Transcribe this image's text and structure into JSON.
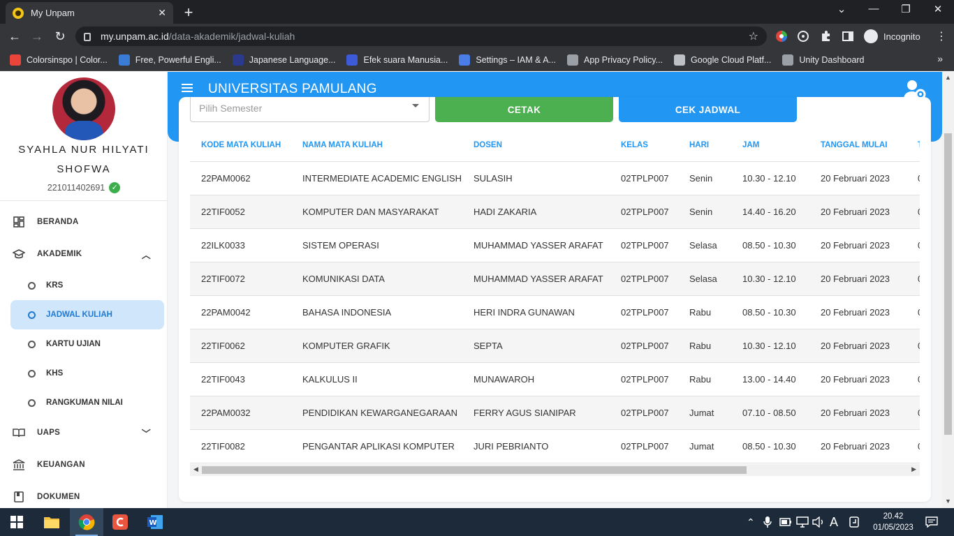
{
  "browser": {
    "tab_title": "My Unpam",
    "tab_close": "✕",
    "new_tab": "+",
    "url_host": "my.unpam.ac.id",
    "url_path": "/data-akademik/jadwal-kuliah",
    "profile_label": "Incognito",
    "window_controls": [
      "⌄",
      "—",
      "❐",
      "✕"
    ]
  },
  "bookmarks": [
    {
      "label": "Colorsinspo | Color...",
      "color": "#e9453a"
    },
    {
      "label": "Free, Powerful Engli...",
      "color": "#3a7bd5"
    },
    {
      "label": "Japanese Language...",
      "color": "#2b3a8c"
    },
    {
      "label": "Efek suara Manusia...",
      "color": "#3d5bd9"
    },
    {
      "label": "Settings – IAM & A...",
      "color": "#4a7de8"
    },
    {
      "label": "App Privacy Policy...",
      "color": "#9aa0a6"
    },
    {
      "label": "Google Cloud Platf...",
      "color": "#bdc1c6"
    },
    {
      "label": "Unity Dashboard",
      "color": "#9aa0a6"
    }
  ],
  "bookmarks_more": "»",
  "profile": {
    "name": "SYAHLA NUR HILYATI SHOFWA",
    "nim": "221011402691",
    "verified_mark": "✓"
  },
  "sidebar": {
    "items": [
      {
        "label": "BERANDA",
        "icon": "dashboard-icon"
      },
      {
        "label": "AKADEMIK",
        "icon": "school-icon"
      },
      {
        "label": "UAPS",
        "icon": "book-icon"
      },
      {
        "label": "KEUANGAN",
        "icon": "bank-icon"
      },
      {
        "label": "DOKUMEN",
        "icon": "document-icon"
      }
    ],
    "akademik_sub": [
      {
        "label": "KRS"
      },
      {
        "label": "JADWAL KULIAH"
      },
      {
        "label": "KARTU UJIAN"
      },
      {
        "label": "KHS"
      },
      {
        "label": "RANGKUMAN NILAI"
      }
    ]
  },
  "header": {
    "brand": "UNIVERSITAS PAMULANG",
    "accent": "#2196f3"
  },
  "controls": {
    "semester_placeholder": "Pilih Semester",
    "cetak_label": "CETAK",
    "cek_jadwal_label": "CEK JADWAL"
  },
  "table": {
    "columns": [
      "KODE MATA KULIAH",
      "NAMA MATA KULIAH",
      "DOSEN",
      "KELAS",
      "HARI",
      "JAM",
      "TANGGAL MULAI",
      "T"
    ],
    "rows": [
      [
        "22PAM0062",
        "INTERMEDIATE ACADEMIC ENGLISH",
        "SULASIH",
        "02TPLP007",
        "Senin",
        "10.30 - 12.10",
        "20 Februari 2023",
        "0"
      ],
      [
        "22TIF0052",
        "KOMPUTER DAN MASYARAKAT",
        "HADI ZAKARIA",
        "02TPLP007",
        "Senin",
        "14.40 - 16.20",
        "20 Februari 2023",
        "0"
      ],
      [
        "22ILK0033",
        "SISTEM OPERASI",
        "MUHAMMAD YASSER ARAFAT",
        "02TPLP007",
        "Selasa",
        "08.50 - 10.30",
        "20 Februari 2023",
        "0"
      ],
      [
        "22TIF0072",
        "KOMUNIKASI DATA",
        "MUHAMMAD YASSER ARAFAT",
        "02TPLP007",
        "Selasa",
        "10.30 - 12.10",
        "20 Februari 2023",
        "0"
      ],
      [
        "22PAM0042",
        "BAHASA INDONESIA",
        "HERI INDRA GUNAWAN",
        "02TPLP007",
        "Rabu",
        "08.50 - 10.30",
        "20 Februari 2023",
        "0"
      ],
      [
        "22TIF0062",
        "KOMPUTER GRAFIK",
        "SEPTA",
        "02TPLP007",
        "Rabu",
        "10.30 - 12.10",
        "20 Februari 2023",
        "0"
      ],
      [
        "22TIF0043",
        "KALKULUS II",
        "MUNAWAROH",
        "02TPLP007",
        "Rabu",
        "13.00 - 14.40",
        "20 Februari 2023",
        "0"
      ],
      [
        "22PAM0032",
        "PENDIDIKAN KEWARGANEGARAAN",
        "FERRY AGUS SIANIPAR",
        "02TPLP007",
        "Jumat",
        "07.10 - 08.50",
        "20 Februari 2023",
        "0"
      ],
      [
        "22TIF0082",
        "PENGANTAR APLIKASI KOMPUTER",
        "JURI PEBRIANTO",
        "02TPLP007",
        "Jumat",
        "08.50 - 10.30",
        "20 Februari 2023",
        "0"
      ]
    ]
  },
  "taskbar": {
    "apps": [
      "windows-start",
      "file-explorer",
      "chrome",
      "canva",
      "word"
    ],
    "time": "20.42",
    "date": "01/05/2023",
    "tray_symbols": [
      "⌃",
      "🎤",
      "▭",
      "⚿",
      "🔊",
      "A"
    ]
  }
}
